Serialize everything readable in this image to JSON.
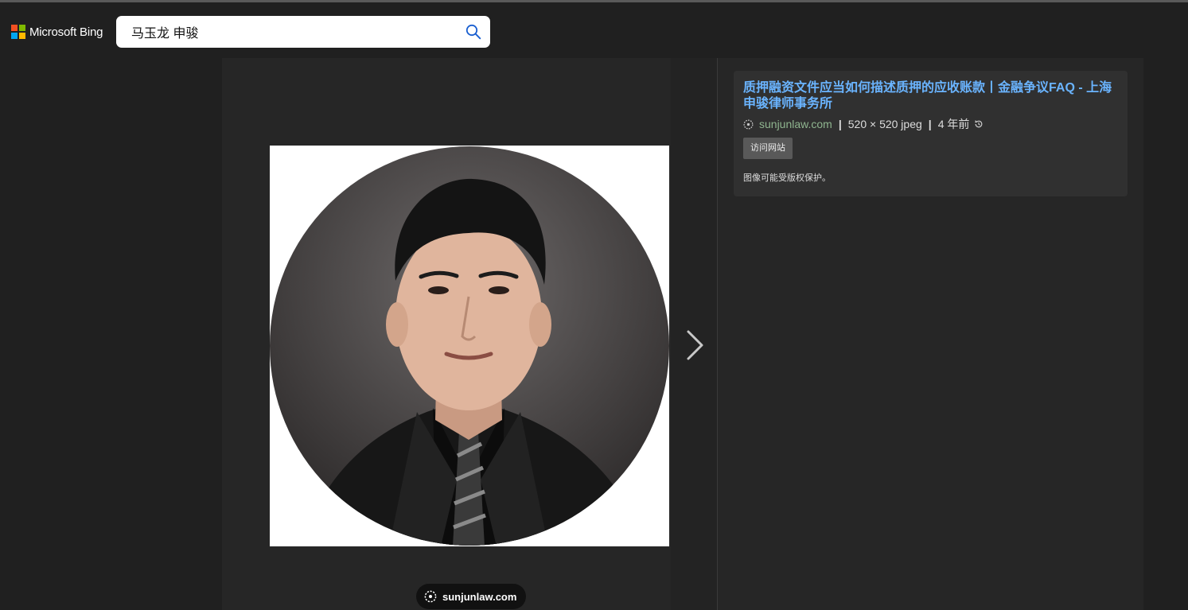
{
  "header": {
    "logo_text": "Microsoft Bing",
    "logo_colors": [
      "#f25022",
      "#7fba00",
      "#00a4ef",
      "#ffb900"
    ],
    "search_value": "马玉龙 申骏"
  },
  "viewer": {
    "source_label": "sunjunlaw.com",
    "image_icon": "person-portrait-icon"
  },
  "details": {
    "title": "质押融资文件应当如何描述质押的应收账款丨金融争议FAQ - 上海申骏律师事务所",
    "domain": "sunjunlaw.com",
    "dimensions": "520 × 520 jpeg",
    "age": "4 年前",
    "visit_button": "访问网站",
    "copyright_note": "图像可能受版权保护。"
  },
  "colors": {
    "link": "#6ab4ff",
    "domain_green": "#8fb58f",
    "background": "#202020"
  }
}
